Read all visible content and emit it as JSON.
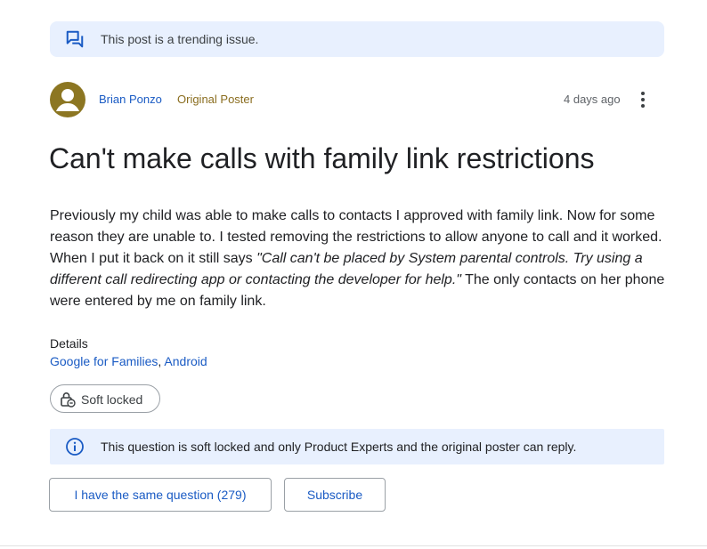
{
  "colors": {
    "accent": "#1a5bc4",
    "banner_bg": "#e8f0fe",
    "avatar": "#8c7622",
    "op_tag": "#8a6d1f"
  },
  "banner": {
    "icon": "forum-icon",
    "text": "This post is a trending issue."
  },
  "post": {
    "author": "Brian Ponzo",
    "author_tag": "Original Poster",
    "time": "4 days ago",
    "title": "Can't make calls with family link restrictions",
    "body_before": "Previously my child was able to make calls to contacts I approved with family link. Now for some reason they are unable to. I tested removing the restrictions to allow anyone to call and it worked. When I put it back on it still says ",
    "body_quote": "\"Call can't be placed by System parental controls. Try using a different call redirecting app or contacting the developer for help.\"",
    "body_after": " The only contacts on her phone were entered by me on family link."
  },
  "details": {
    "label": "Details",
    "links": [
      "Google for Families",
      "Android"
    ],
    "separator": ", "
  },
  "lock_chip": {
    "icon": "lock-icon",
    "label": "Soft locked"
  },
  "notice": {
    "icon": "info-icon",
    "text": "This question is soft locked and only Product Experts and the original poster can reply."
  },
  "actions": {
    "same_question": "I have the same question (279)",
    "subscribe": "Subscribe"
  }
}
